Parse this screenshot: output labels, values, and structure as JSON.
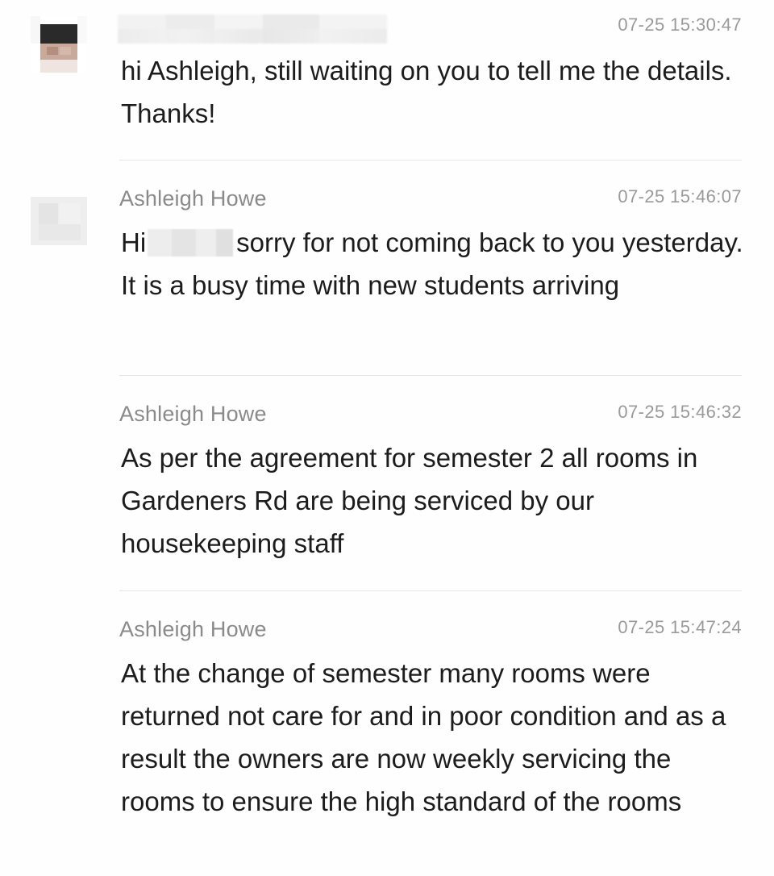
{
  "messages": [
    {
      "sender": "",
      "time": "07-25 15:30:47",
      "text": "hi Ashleigh, still waiting on you to tell me the details. Thanks!"
    },
    {
      "sender": "Ashleigh Howe",
      "time": "07-25 15:46:07",
      "text_before": "Hi",
      "text_after": "sorry for not coming back to you yesterday. It is a busy time with new students arriving"
    },
    {
      "sender": "Ashleigh Howe",
      "time": "07-25 15:46:32",
      "text": "As per the agreement for semester 2 all rooms in Gardeners Rd are being serviced by our housekeeping staff"
    },
    {
      "sender": "Ashleigh Howe",
      "time": "07-25 15:47:24",
      "text": "At the change of semester many rooms were returned not care for and in poor condition and as a result the owners are now weekly servicing the rooms to ensure the high standard of the rooms"
    }
  ],
  "colors": {
    "background": "#fefefe",
    "body_text": "#1c1c1c",
    "sender_name": "#8a8a8a",
    "timestamp": "#9a9a9a",
    "divider": "#e6e6e6"
  },
  "icons": {
    "avatar_1": "pixelated-avatar",
    "avatar_2": "pixelated-avatar"
  }
}
